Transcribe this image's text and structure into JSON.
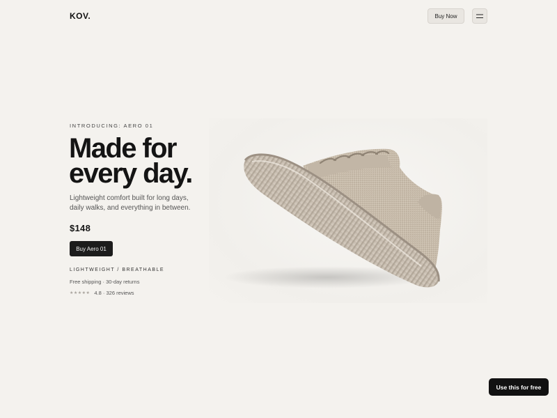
{
  "header": {
    "logo": "KOV.",
    "buy_now_label": "Buy Now",
    "menu_icon": "hamburger-menu-icon"
  },
  "hero": {
    "eyebrow": "INTRODUCING: AERO 01",
    "headline_line1": "Made for",
    "headline_line2": "every day.",
    "description": "Lightweight comfort built for long days, daily walks, and everything in between.",
    "price": "$148",
    "cta_label": "Buy Aero 01",
    "features": "LIGHTWEIGHT / BREATHABLE",
    "shipping": "Free shipping · 30-day returns",
    "stars": "★★★★★",
    "rating_text": "4.8 · 326 reviews",
    "rating_value": 4.8,
    "image_icon": "sneaker-product-image"
  },
  "floating_cta": {
    "label": "Use this for free"
  },
  "colors": {
    "background": "#f4f2ee",
    "primary_dark": "#1c1c1c",
    "shoe_knit": "#cbbfae"
  }
}
